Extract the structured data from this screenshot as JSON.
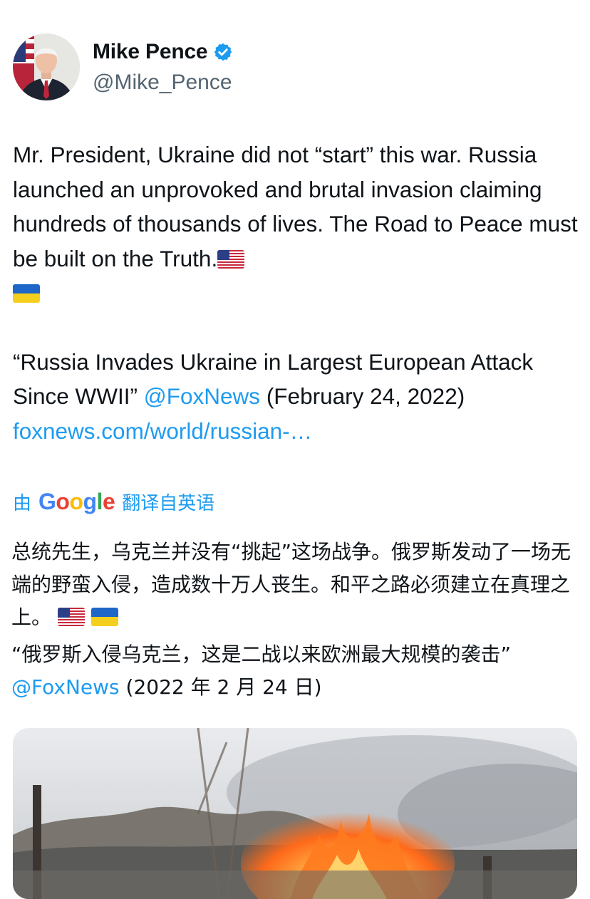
{
  "author": {
    "display_name": "Mike Pence",
    "handle": "@Mike_Pence",
    "avatar_icon": "profile-photo",
    "verified_icon": "verified-badge-icon",
    "verified_color": "#1d9bf0"
  },
  "tweet": {
    "text_main": "Mr. President, Ukraine did not “start” this war. Russia launched an unprovoked and brutal invasion claiming hundreds of thousands of lives. The Road to Peace must be built on the Truth.",
    "quote_headline": "“Russia Invades Ukraine in Largest European Attack Since WWII”",
    "mention": "@FoxNews",
    "date_text": "(February 24, 2022)",
    "url": "foxnews.com/world/russian-…",
    "flags": [
      "us-flag-icon",
      "ukraine-flag-icon"
    ]
  },
  "translation": {
    "prefix": "由",
    "provider": "Google",
    "suffix": "翻译自英语",
    "text_main": "总统先生，乌克兰并没有“挑起”这场战争。俄罗斯发动了一场无端的野蛮入侵，造成数十万人丧生。和平之路必须建立在真理之上。",
    "quote_headline": "“俄罗斯入侵乌克兰，这是二战以来欧洲最大规模的袭击”",
    "mention": "@FoxNews",
    "date_text": "(2022 年 2 月 24 日)"
  },
  "media": {
    "icon": "news-photo-fire"
  },
  "colors": {
    "link": "#1d9bf0",
    "text": "#0f1419",
    "secondary": "#536471"
  }
}
